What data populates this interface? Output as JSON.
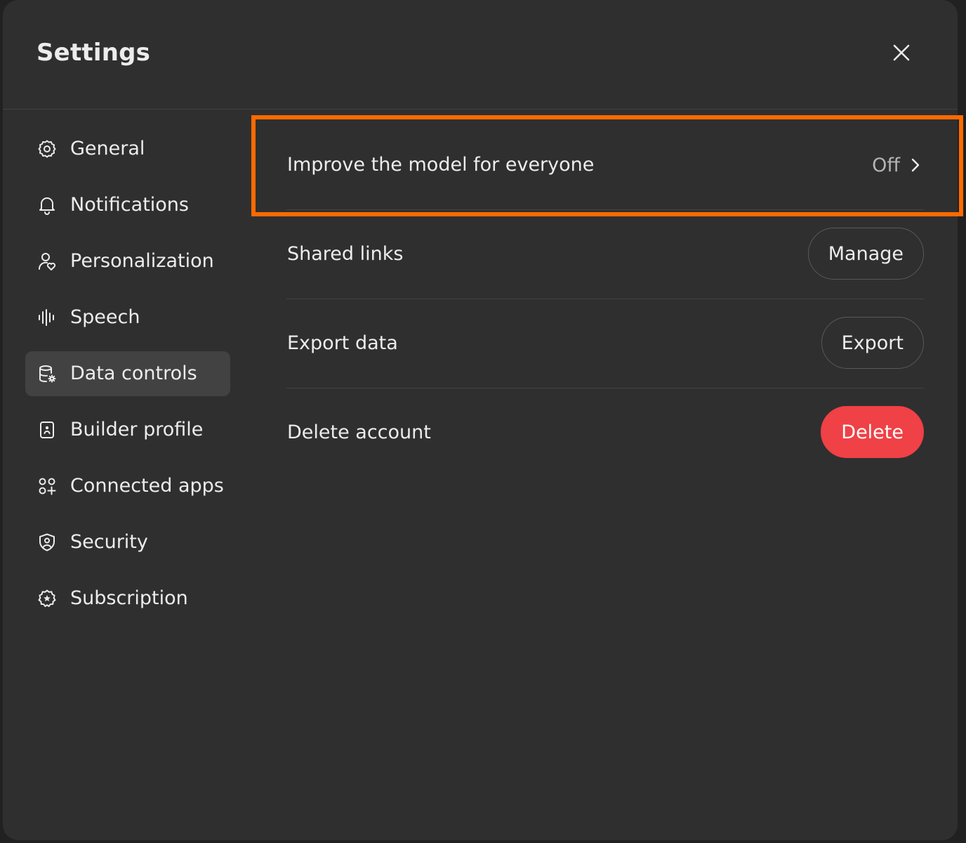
{
  "modal": {
    "title": "Settings",
    "close_icon": "close-icon"
  },
  "sidebar": {
    "items": [
      {
        "label": "General",
        "icon": "gear-icon",
        "active": false
      },
      {
        "label": "Notifications",
        "icon": "bell-icon",
        "active": false
      },
      {
        "label": "Personalization",
        "icon": "person-heart-icon",
        "active": false
      },
      {
        "label": "Speech",
        "icon": "waveform-icon",
        "active": false
      },
      {
        "label": "Data controls",
        "icon": "database-gear-icon",
        "active": true
      },
      {
        "label": "Builder profile",
        "icon": "id-badge-icon",
        "active": false
      },
      {
        "label": "Connected apps",
        "icon": "apps-grid-icon",
        "active": false
      },
      {
        "label": "Security",
        "icon": "shield-user-icon",
        "active": false
      },
      {
        "label": "Subscription",
        "icon": "star-badge-icon",
        "active": false
      }
    ]
  },
  "data_controls": {
    "improve_model": {
      "label": "Improve the model for everyone",
      "value": "Off",
      "icon": "chevron-right-icon"
    },
    "shared_links": {
      "label": "Shared links",
      "button": "Manage"
    },
    "export_data": {
      "label": "Export data",
      "button": "Export"
    },
    "delete_account": {
      "label": "Delete account",
      "button": "Delete"
    }
  },
  "colors": {
    "modal_bg": "#2f2f2f",
    "active_item_bg": "#424242",
    "danger": "#ef4146",
    "highlight": "#ff6a00",
    "text": "#ececec"
  }
}
